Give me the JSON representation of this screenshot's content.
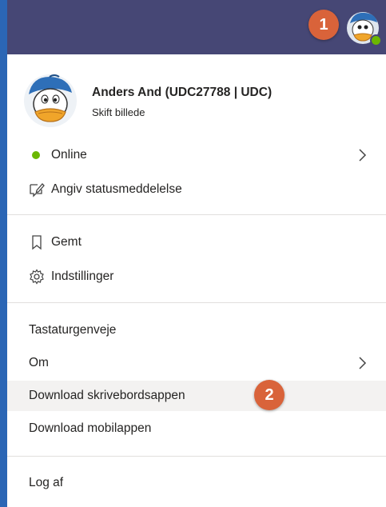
{
  "header": {
    "badge_1": "1",
    "accent_color": "#464775",
    "avatar_icon": "donald-duck-avatar-icon",
    "presence_color": "#6bb700"
  },
  "profile": {
    "name": "Anders And (UDC27788 | UDC)",
    "change_photo": "Skift billede",
    "avatar_icon": "donald-duck-avatar-icon"
  },
  "status": {
    "label": "Online",
    "color": "#6bb700",
    "set_message": "Angiv statusmeddelelse"
  },
  "menu": {
    "saved": "Gemt",
    "settings": "Indstillinger",
    "keyboard_shortcuts": "Tastaturgenveje",
    "about": "Om",
    "download_desktop": "Download skrivebordsappen",
    "download_mobile": "Download mobilappen",
    "sign_out": "Log af"
  },
  "callout": {
    "badge_2": "2",
    "color": "#d9633a"
  }
}
